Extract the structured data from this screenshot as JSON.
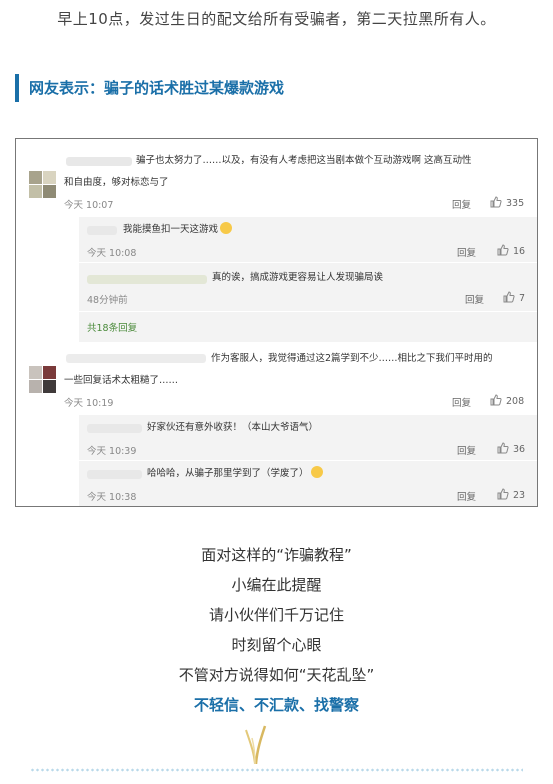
{
  "top_text": "早上10点，发过生日的配文给所有受骗者，第二天拉黑所有人。",
  "section_heading": "网友表示：骗子的话术胜过某爆款游戏",
  "comments": {
    "c1": {
      "text_line1": "骗子也太努力了……以及，有没有人考虑把这当剧本做个互动游戏啊 这高互动性",
      "text_line2": "和自由度，够对标恋与了",
      "time": "今天 10:07",
      "reply": "回复",
      "likes": "335"
    },
    "r1": {
      "text": "我能摸鱼扣一天这游戏",
      "time": "今天 10:08",
      "reply": "回复",
      "likes": "16"
    },
    "r2": {
      "text": "真的诶，搞成游戏更容易让人发现骗局诶",
      "time": "48分钟前",
      "reply": "回复",
      "likes": "7"
    },
    "more_replies": "共18条回复",
    "c2": {
      "text_line1": "作为客服人，我觉得通过这2篇学到不少……相比之下我们平时用的",
      "text_line2": "一些回复话术太粗糙了……",
      "time": "今天 10:19",
      "reply": "回复",
      "likes": "208"
    },
    "r3": {
      "text": "好家伙还有意外收获！（本山大爷语气）",
      "time": "今天 10:39",
      "reply": "回复",
      "likes": "36"
    },
    "r4": {
      "text": "哈哈哈，从骗子那里学到了（学废了）",
      "time": "今天 10:38",
      "reply": "回复",
      "likes": "23"
    }
  },
  "middle_lines": [
    "面对这样的“诈骗教程”",
    "小编在此提醒",
    "请小伙伴们千万记住",
    "时刻留个心眼",
    "不管对方说得如何“天花乱坠”"
  ],
  "emphasis": "不轻信、不汇款、找警察",
  "colors": {
    "accent": "#1a6fa8",
    "reply_bg": "#f3f3f3",
    "more_green": "#4a8a3a"
  },
  "icons": {
    "like": "thumbs-up-icon",
    "emoji": "laughing-emoji-icon",
    "decoration": "wheat-ear-icon"
  }
}
